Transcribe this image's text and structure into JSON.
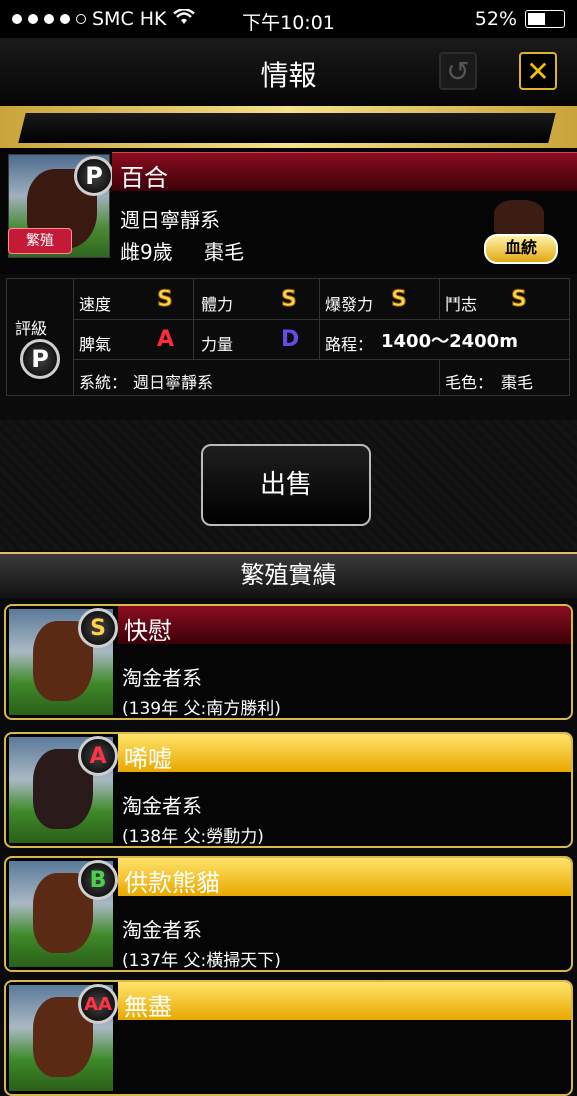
{
  "status": {
    "carrier": "SMC HK",
    "time": "下午10:01",
    "battery": "52%",
    "battery_level": 0.52
  },
  "header": {
    "title": "情報"
  },
  "horse": {
    "rank": "P",
    "name": "百合",
    "line": "週日寧靜系",
    "gender_age": "雌9歲",
    "coat": "棗毛",
    "tag": "繁殖",
    "pedigree_label": "血統"
  },
  "stats": {
    "grade_label": "評級",
    "grade": "P",
    "speed_label": "速度",
    "speed": "S",
    "stamina_label": "體力",
    "stamina": "S",
    "burst_label": "爆發力",
    "burst": "S",
    "spirit_label": "鬥志",
    "spirit": "S",
    "temper_label": "脾氣",
    "temper": "A",
    "power_label": "力量",
    "power": "D",
    "distance_label": "路程：",
    "distance": "1400～2400m",
    "system_label": "系統：",
    "system": "週日寧靜系",
    "coat_label": "毛色：",
    "coat": "棗毛"
  },
  "actions": {
    "sell": "出售"
  },
  "section": {
    "title": "繁殖實績"
  },
  "offspring": [
    {
      "rank": "S",
      "name": "快慰",
      "line": "淘金者系",
      "detail": "(139年 父:南方勝利)",
      "bar": "red"
    },
    {
      "rank": "A",
      "name": "唏嘘",
      "line": "淘金者系",
      "detail": "(138年 父:勞動力)",
      "bar": "gold"
    },
    {
      "rank": "B",
      "name": "供款熊貓",
      "line": "淘金者系",
      "detail": "(137年 父:橫掃天下)",
      "bar": "gold"
    },
    {
      "rank": "AA",
      "name": "無盡",
      "line": "",
      "detail": "",
      "bar": "gold"
    }
  ]
}
